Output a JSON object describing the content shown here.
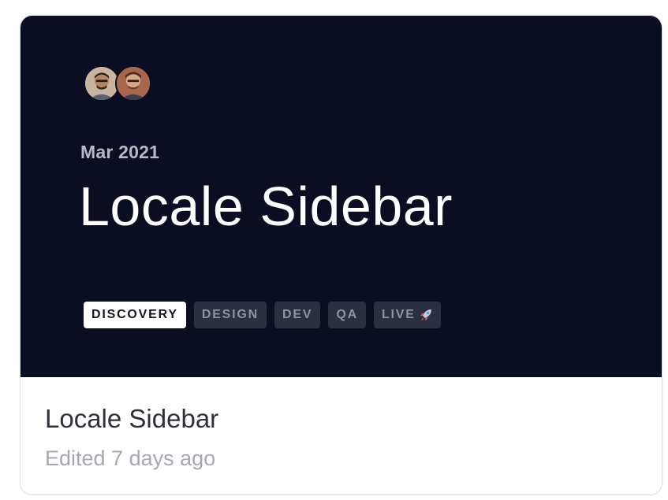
{
  "card": {
    "cover": {
      "date": "Mar 2021",
      "title": "Locale Sidebar",
      "avatars": [
        "avatar-user-1",
        "avatar-user-2"
      ],
      "stages": [
        {
          "label": "DISCOVERY",
          "active": true
        },
        {
          "label": "DESIGN",
          "active": false
        },
        {
          "label": "DEV",
          "active": false
        },
        {
          "label": "QA",
          "active": false
        },
        {
          "label": "LIVE",
          "active": false,
          "icon": "rocket-icon"
        }
      ]
    },
    "footer": {
      "title": "Locale Sidebar",
      "meta": "Edited 7 days ago"
    }
  },
  "colors": {
    "cover_bg": "#0b0e22",
    "stage_inactive_bg": "#2b2f42",
    "stage_active_bg": "#ffffff"
  }
}
